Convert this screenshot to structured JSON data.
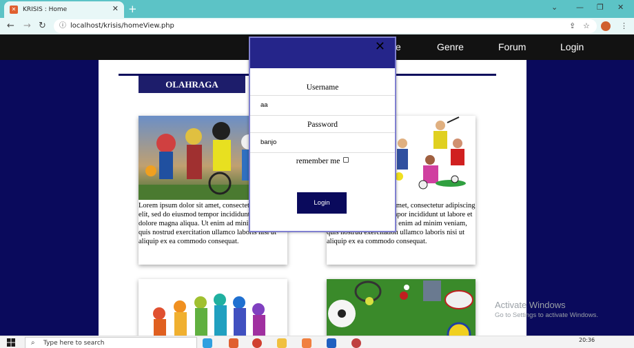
{
  "browser": {
    "tab_title": "KRISIS : Home",
    "tab_favicon": "xampp-icon",
    "url": "localhost/krisis/homeView.php"
  },
  "nav": {
    "items": [
      "Home",
      "Genre",
      "Forum",
      "Login"
    ],
    "partial_visible": "e"
  },
  "section": {
    "title": "OLAHRAGA"
  },
  "cards": [
    {
      "image": "cyclists-athletes-collage",
      "text": "Lorem ipsum dolor sit amet, consectetur adipiscing elit, sed do eiusmod tempor incididunt ut labore et dolore magna aliqua. Ut enim ad minim veniam, quis nostrud exercitation ullamco laboris nisi ut aliquip ex ea commodo consequat."
    },
    {
      "image": "sports-illustration",
      "text": "Lorem ipsum dolor sit amet, consectetur adipiscing elit, sed do eiusmod tempor incididunt ut labore et dolore magna aliqua. Ut enim ad minim veniam, quis nostrud exercitation ullamco laboris nisi ut aliquip ex ea commodo consequat."
    },
    {
      "image": "colorful-athletes-silhouettes"
    },
    {
      "image": "sports-balls-on-grass"
    }
  ],
  "login_modal": {
    "close_symbol": "✕",
    "username_label": "Username",
    "username_value": "aa",
    "password_label": "Password",
    "password_value": "banjo",
    "remember_label": "remember me",
    "remember_checked": false,
    "button_label": "Login"
  },
  "watermark": {
    "title": "Activate Windows",
    "subtitle": "Go to Settings to activate Windows."
  },
  "taskbar": {
    "search_placeholder": "Type here to search",
    "time": "20:36"
  },
  "colors": {
    "navy": "#0a0a5c",
    "modal_header": "#25258a",
    "tabbar": "#5cc3c6",
    "navbar": "#121212"
  }
}
